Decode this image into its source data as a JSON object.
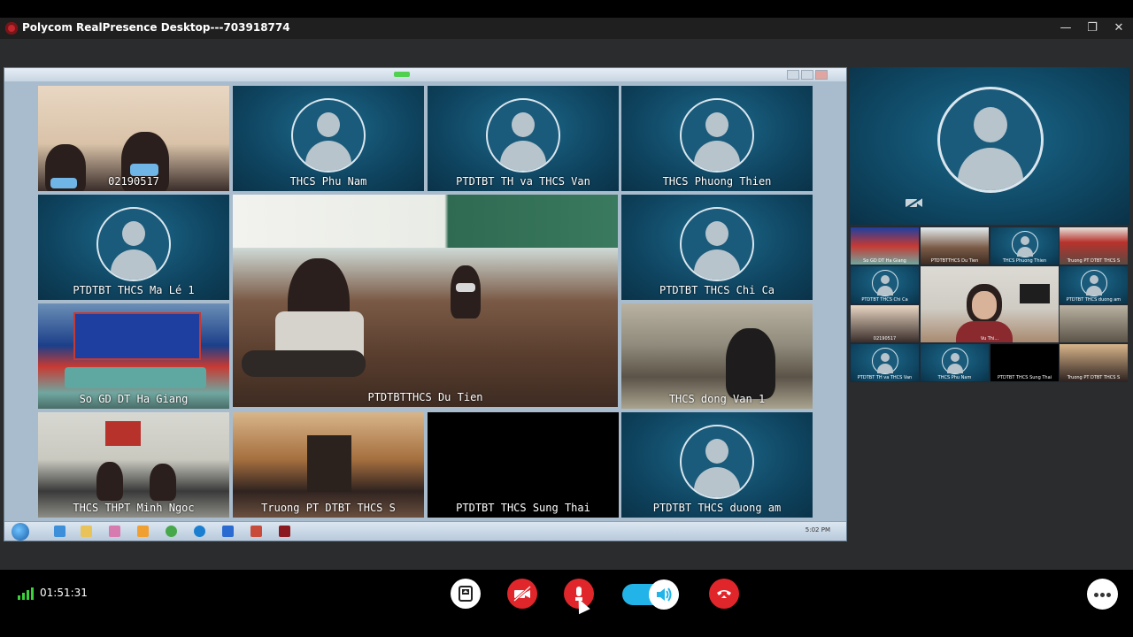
{
  "window": {
    "title": "Polycom RealPresence Desktop---703918774",
    "minimize_label": "—",
    "restore_label": "❐",
    "close_label": "✕"
  },
  "share": {
    "clock": "5:02 PM",
    "tiles": [
      {
        "label": "02190517",
        "kind": "photo1"
      },
      {
        "label": "THCS Phu Nam",
        "kind": "avatar"
      },
      {
        "label": "PTDTBT TH va THCS Van",
        "kind": "avatar"
      },
      {
        "label": "THCS Phuong Thien",
        "kind": "avatar"
      },
      {
        "label": "PTDTBT THCS Ma Lé 1",
        "kind": "avatar"
      },
      {
        "label": "PTDTBTTHCS Du Tien",
        "kind": "big"
      },
      {
        "label": "PTDTBT THCS Chi Ca",
        "kind": "avatar"
      },
      {
        "label": "So GD DT Ha Giang",
        "kind": "photo2"
      },
      {
        "label": "THCS dong Van 1",
        "kind": "photo5"
      },
      {
        "label": "THCS THPT Minh Ngoc",
        "kind": "photo3"
      },
      {
        "label": "Truong PT DTBT THCS S",
        "kind": "photo4"
      },
      {
        "label": "PTDTBT THCS Sung Thai",
        "kind": "black"
      },
      {
        "label": "PTDTBT THCS duong am",
        "kind": "avatar"
      }
    ]
  },
  "thumbs": [
    {
      "label": "So GD DT Ha Giang"
    },
    {
      "label": "PTDTBTTHCS Du Tien"
    },
    {
      "label": "THCS Phuong Thien"
    },
    {
      "label": "Truong PT DTBT THCS S"
    },
    {
      "label": "PTDTBT THCS Chi Ca"
    },
    {
      "label": "Vu Thi..."
    },
    {
      "label": "PTDTBT THCS duong am"
    },
    {
      "label": "02190517"
    },
    {
      "label": "PTDTBT TH va THCS Van"
    },
    {
      "label": "THCS Phu Nam"
    },
    {
      "label": "PTDTBT THCS Sung Thai"
    },
    {
      "label": "Truong PT DTBT THCS S"
    }
  ],
  "status": {
    "call_timer": "01:51:31",
    "speaker_volume_on": true
  },
  "colors": {
    "end_call": "#e0262b",
    "camera_off": "#e0262b",
    "toggle": "#22b4e8",
    "signal": "#3bd13b"
  }
}
